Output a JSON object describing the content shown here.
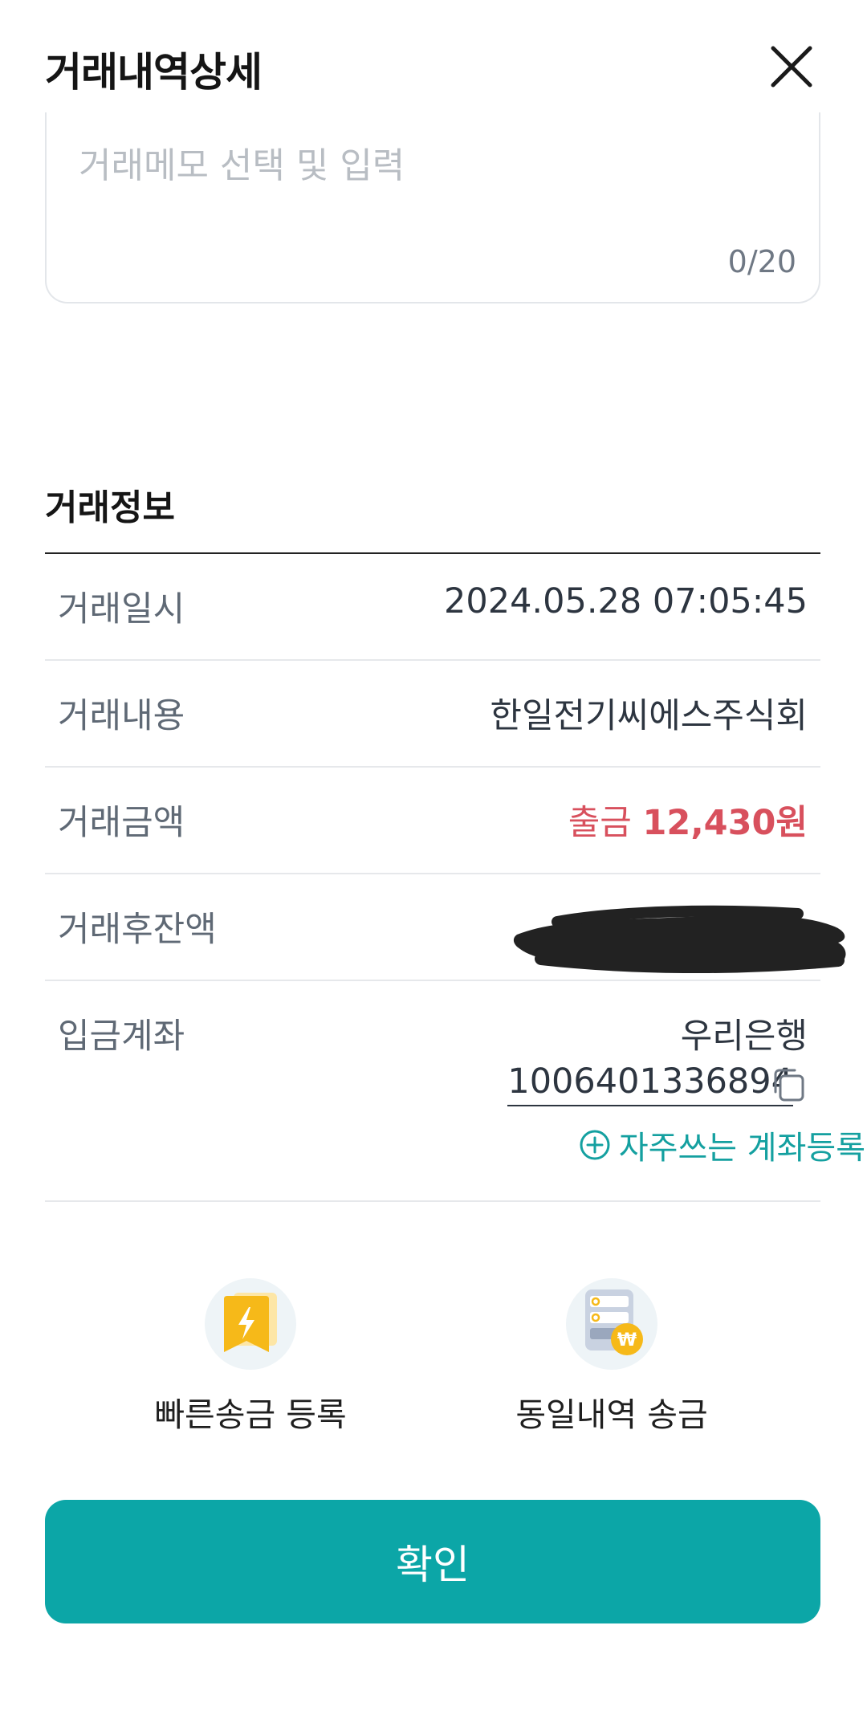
{
  "header": {
    "title": "거래내역상세"
  },
  "memo": {
    "placeholder": "거래메모 선택 및 입력",
    "counter": "0/20"
  },
  "transaction_info": {
    "section_title": "거래정보",
    "rows": [
      {
        "label": "거래일시",
        "value": "2024.05.28 07:05:45"
      },
      {
        "label": "거래내용",
        "value": "한일전기씨에스주식회"
      },
      {
        "label": "거래금액",
        "type": "출금",
        "amount": "12,430원"
      },
      {
        "label": "거래후잔액",
        "value_redacted": true
      },
      {
        "label": "입금계좌",
        "bank": "우리은행",
        "account_number": "1006401336894"
      }
    ],
    "favorite_account_link": "자주쓰는 계좌등록"
  },
  "actions": [
    {
      "label": "빠른송금 등록",
      "icon": "quick-transfer-bookmark-icon"
    },
    {
      "label": "동일내역 송금",
      "icon": "same-transaction-transfer-icon"
    }
  ],
  "confirm_button": {
    "label": "확인"
  },
  "colors": {
    "primary": "#0ca6a7",
    "withdrawal": "#d8505d",
    "label_gray": "#5f6975"
  }
}
